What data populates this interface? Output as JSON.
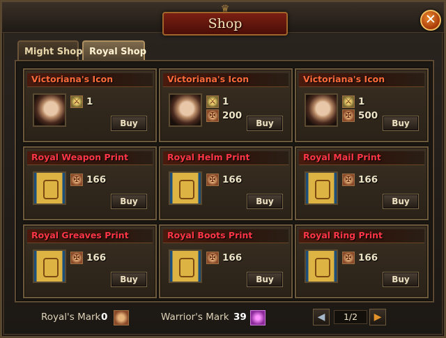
{
  "window": {
    "title": "Shop",
    "close_label": "✕"
  },
  "tabs": [
    {
      "label": "Might Shop",
      "active": false
    },
    {
      "label": "Royal Shop",
      "active": true
    }
  ],
  "items": [
    {
      "title": "Victoriana's Icon",
      "title_color": "orange",
      "icon": "portrait-icon",
      "costs": [
        "1"
      ],
      "buy_label": "Buy"
    },
    {
      "title": "Victoriana's Icon",
      "title_color": "orange",
      "icon": "portrait-icon",
      "costs": [
        "1",
        "200"
      ],
      "buy_label": "Buy"
    },
    {
      "title": "Victoriana's Icon",
      "title_color": "orange",
      "icon": "portrait-icon",
      "costs": [
        "1",
        "500"
      ],
      "buy_label": "Buy"
    },
    {
      "title": "Royal Weapon Print",
      "title_color": "red",
      "icon": "scroll-icon",
      "costs": [
        "166"
      ],
      "buy_label": "Buy"
    },
    {
      "title": "Royal Helm Print",
      "title_color": "red",
      "icon": "scroll-icon",
      "costs": [
        "166"
      ],
      "buy_label": "Buy"
    },
    {
      "title": "Royal Mail Print",
      "title_color": "red",
      "icon": "scroll-icon",
      "costs": [
        "166"
      ],
      "buy_label": "Buy"
    },
    {
      "title": "Royal Greaves Print",
      "title_color": "red",
      "icon": "scroll-icon",
      "costs": [
        "166"
      ],
      "buy_label": "Buy"
    },
    {
      "title": "Royal Boots Print",
      "title_color": "red",
      "icon": "scroll-icon",
      "costs": [
        "166"
      ],
      "buy_label": "Buy"
    },
    {
      "title": "Royal Ring Print",
      "title_color": "red",
      "icon": "scroll-icon",
      "costs": [
        "166"
      ],
      "buy_label": "Buy"
    }
  ],
  "footer": {
    "royal_mark_label": "Royal's Mark",
    "royal_mark_value": "0",
    "warrior_mark_label": "Warrior's Mark",
    "warrior_mark_value": "39",
    "page": "1/2",
    "prev_label": "◀",
    "next_label": "▶"
  },
  "colors": {
    "title_orange": "#ff6b3a",
    "title_red": "#ff3646",
    "accent_gold": "#e0912a"
  }
}
